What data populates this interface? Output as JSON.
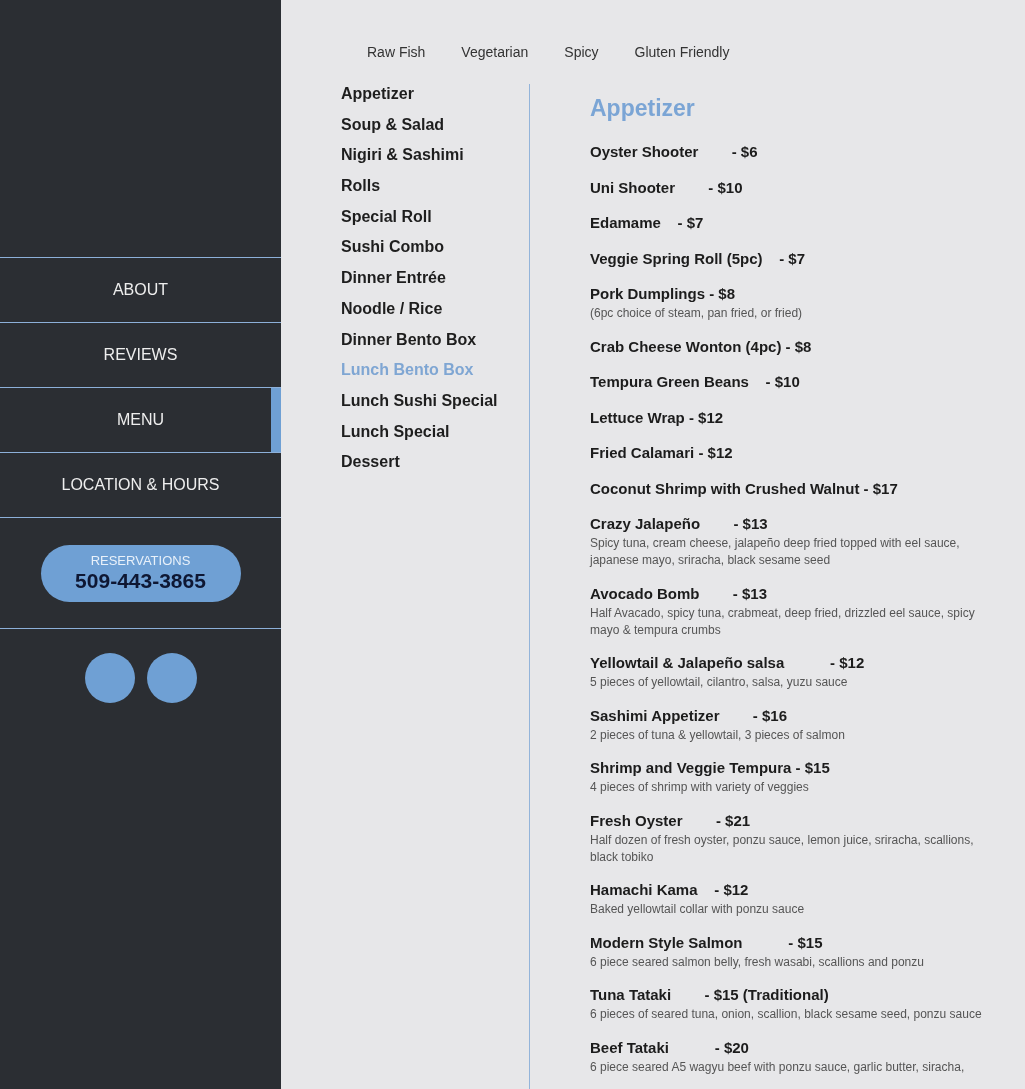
{
  "sidebar": {
    "nav": [
      {
        "label": "ABOUT",
        "selected": false
      },
      {
        "label": "REVIEWS",
        "selected": false
      },
      {
        "label": "MENU",
        "selected": true
      },
      {
        "label": "LOCATION & HOURS",
        "selected": false
      }
    ],
    "reservations": {
      "label": "RESERVATIONS",
      "phone": "509-443-3865"
    }
  },
  "filters": [
    "Raw Fish",
    "Vegetarian",
    "Spicy",
    "Gluten Friendly"
  ],
  "categories": [
    {
      "label": "Appetizer",
      "selected": false
    },
    {
      "label": "Soup & Salad",
      "selected": false
    },
    {
      "label": "Nigiri & Sashimi",
      "selected": false
    },
    {
      "label": "Rolls",
      "selected": false
    },
    {
      "label": "Special Roll",
      "selected": false
    },
    {
      "label": "Sushi Combo",
      "selected": false
    },
    {
      "label": "Dinner Entrée",
      "selected": false
    },
    {
      "label": "Noodle / Rice",
      "selected": false
    },
    {
      "label": "Dinner Bento Box",
      "selected": false
    },
    {
      "label": "Lunch Bento Box",
      "selected": true
    },
    {
      "label": "Lunch Sushi Special",
      "selected": false
    },
    {
      "label": "Lunch Special",
      "selected": false
    },
    {
      "label": "Dessert",
      "selected": false
    }
  ],
  "menu": {
    "heading": "Appetizer",
    "items": [
      {
        "title": "Oyster Shooter        - $6"
      },
      {
        "title": "Uni Shooter        - $10"
      },
      {
        "title": "Edamame    - $7"
      },
      {
        "title": "Veggie Spring Roll (5pc)    - $7"
      },
      {
        "title": "Pork Dumplings - $8",
        "description": "(6pc choice of steam, pan fried, or fried)"
      },
      {
        "title": "Crab Cheese Wonton (4pc) - $8"
      },
      {
        "title": "Tempura Green Beans    - $10"
      },
      {
        "title": "Lettuce Wrap - $12"
      },
      {
        "title": "Fried Calamari - $12"
      },
      {
        "title": "Coconut Shrimp with Crushed Walnut - $17"
      },
      {
        "title": "Crazy Jalapeño        - $13",
        "description": "Spicy tuna, cream cheese, jalapeño deep fried topped with eel sauce, japanese mayo, sriracha, black sesame seed"
      },
      {
        "title": "Avocado Bomb        - $13",
        "description": "Half Avacado, spicy tuna, crabmeat, deep fried, drizzled eel sauce, spicy mayo & tempura crumbs"
      },
      {
        "title": "Yellowtail & Jalapeño salsa           - $12",
        "description": "5 pieces of yellowtail, cilantro, salsa, yuzu sauce"
      },
      {
        "title": "Sashimi Appetizer        - $16",
        "description": "2 pieces of tuna & yellowtail, 3 pieces of salmon"
      },
      {
        "title": "Shrimp and Veggie Tempura - $15",
        "description": "4 pieces of shrimp with variety of veggies"
      },
      {
        "title": "Fresh Oyster        - $21",
        "description": "Half dozen of fresh oyster, ponzu sauce, lemon juice, sriracha, scallions, black tobiko"
      },
      {
        "title": "Hamachi Kama    - $12",
        "description": "Baked yellowtail collar with ponzu sauce"
      },
      {
        "title": "Modern Style Salmon           - $15",
        "description": "6 piece seared salmon belly, fresh wasabi, scallions and ponzu"
      },
      {
        "title": "Tuna Tataki        - $15 (Traditional)",
        "description": "6 pieces of seared tuna, onion, scallion, black sesame seed, ponzu sauce"
      },
      {
        "title": "Beef Tataki           - $20",
        "description": "6 piece seared A5 wagyu beef with ponzu sauce, garlic butter, siracha,"
      }
    ]
  }
}
